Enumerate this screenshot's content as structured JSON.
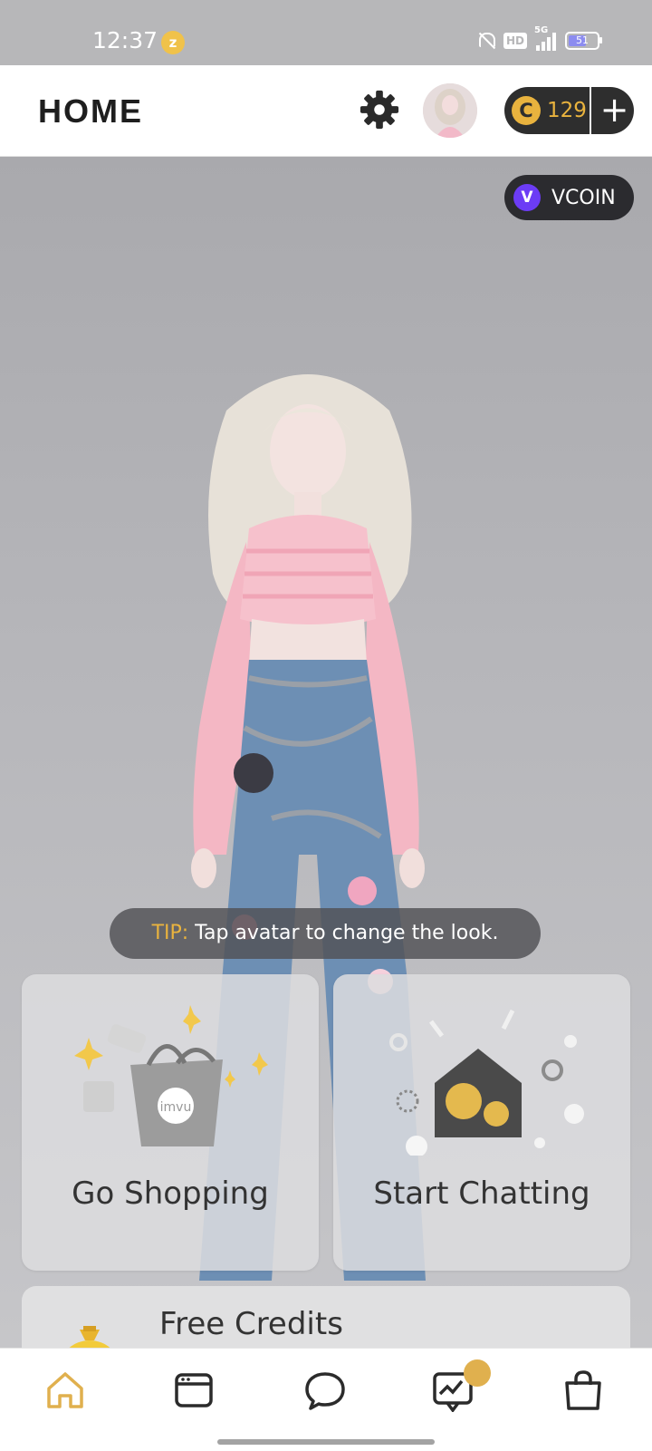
{
  "status": {
    "time": "12:37",
    "battery": "51",
    "hd": "HD",
    "network": "5G"
  },
  "header": {
    "title": "HOME",
    "credits": "129",
    "add_symbol": "+"
  },
  "vcoin": {
    "label": "VCOIN"
  },
  "tip": {
    "label": "TIP:",
    "text": "Tap avatar to change the look."
  },
  "cards": [
    {
      "label": "Go Shopping"
    },
    {
      "label": "Start Chatting"
    }
  ],
  "free_credits": {
    "label": "Free Credits"
  },
  "icons": {
    "settings": "gear-icon",
    "nav": [
      "home-icon",
      "feed-icon",
      "chat-icon",
      "activity-icon",
      "shop-bag-icon"
    ]
  },
  "colors": {
    "accent_gold": "#e9b33e",
    "vcoin_purple": "#6c3cf5",
    "dark_pill": "#2e2e2e"
  }
}
